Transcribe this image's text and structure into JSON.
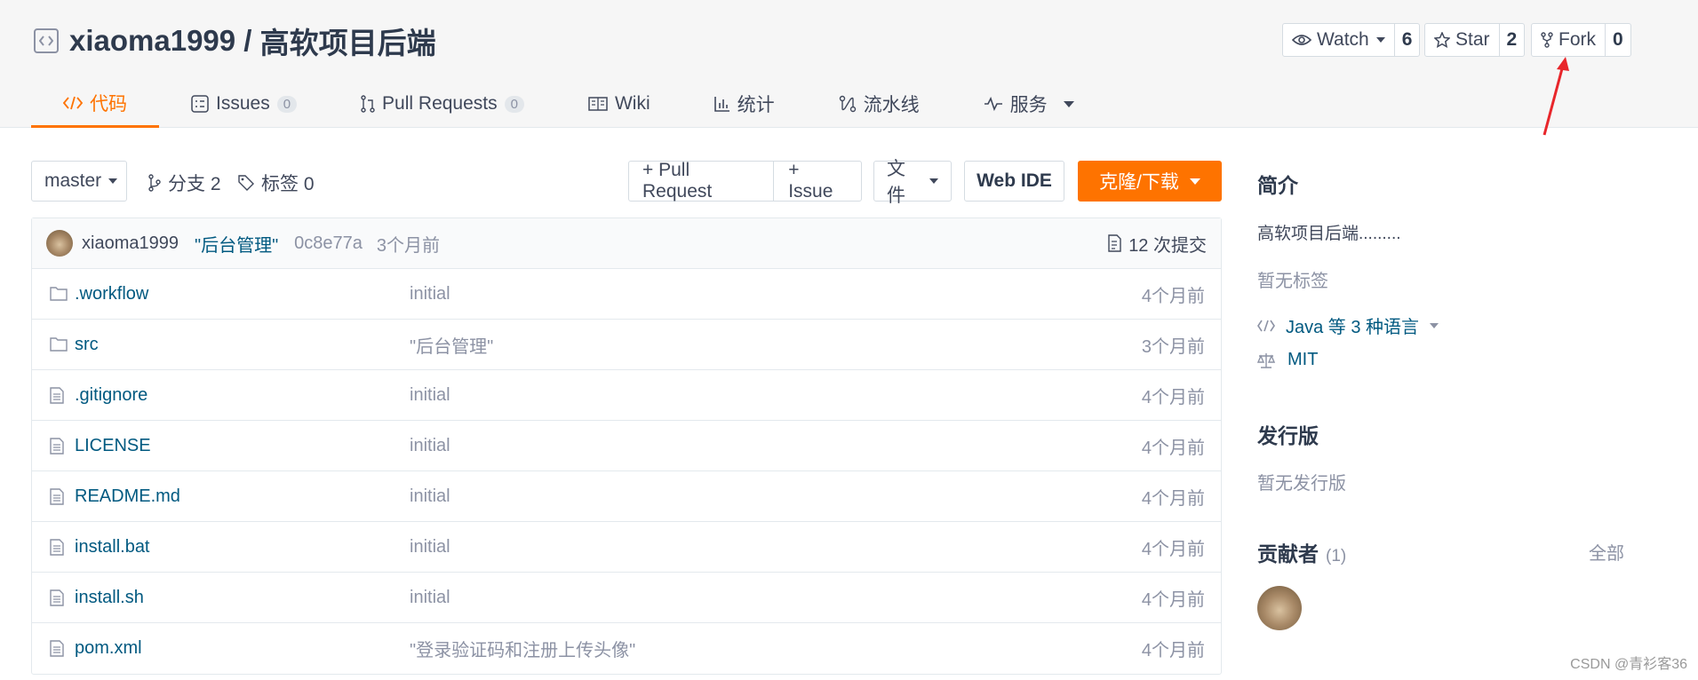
{
  "repo": {
    "owner": "xiaoma1999",
    "separator": " / ",
    "name": "高软项目后端"
  },
  "social": {
    "watch_label": "Watch",
    "watch_count": "6",
    "star_label": "Star",
    "star_count": "2",
    "fork_label": "Fork",
    "fork_count": "0"
  },
  "tabs": [
    {
      "label": "代码",
      "icon": "code-icon",
      "active": true
    },
    {
      "label": "Issues",
      "badge": "0",
      "icon": "issues-icon"
    },
    {
      "label": "Pull Requests",
      "badge": "0",
      "icon": "pull-request-icon"
    },
    {
      "label": "Wiki",
      "icon": "wiki-icon"
    },
    {
      "label": "统计",
      "icon": "stats-icon"
    },
    {
      "label": "流水线",
      "icon": "pipeline-icon"
    },
    {
      "label": "服务",
      "icon": "service-icon"
    }
  ],
  "toolbar": {
    "branch": "master",
    "branches": "分支 2",
    "tags": "标签 0",
    "pull_request": "+ Pull Request",
    "issue": "+ Issue",
    "file": "文件",
    "web_ide": "Web IDE",
    "clone": "克隆/下载"
  },
  "commit": {
    "author": "xiaoma1999",
    "message": "\"后台管理\"",
    "hash": "0c8e77a",
    "time": "3个月前",
    "count": "12 次提交"
  },
  "files": [
    {
      "name": ".workflow",
      "type": "folder",
      "message": "initial",
      "time": "4个月前"
    },
    {
      "name": "src",
      "type": "folder",
      "message": "\"后台管理\"",
      "time": "3个月前"
    },
    {
      "name": ".gitignore",
      "type": "file",
      "message": "initial",
      "time": "4个月前"
    },
    {
      "name": "LICENSE",
      "type": "file",
      "message": "initial",
      "time": "4个月前"
    },
    {
      "name": "README.md",
      "type": "file",
      "message": "initial",
      "time": "4个月前"
    },
    {
      "name": "install.bat",
      "type": "file",
      "message": "initial",
      "time": "4个月前"
    },
    {
      "name": "install.sh",
      "type": "file",
      "message": "initial",
      "time": "4个月前"
    },
    {
      "name": "pom.xml",
      "type": "file",
      "message": "\"登录验证码和注册上传头像\"",
      "time": "4个月前"
    }
  ],
  "sidebar": {
    "intro_title": "简介",
    "intro_text": "高软项目后端.........",
    "no_tags": "暂无标签",
    "languages": "Java 等 3 种语言",
    "license": "MIT",
    "release_title": "发行版",
    "no_release": "暂无发行版",
    "contributors_title": "贡献者",
    "contributors_count": "(1)",
    "all_link": "全部"
  },
  "watermark": "CSDN @青衫客36",
  "colors": {
    "accent": "#fe7300",
    "link": "#005980",
    "muted": "#8c92a4"
  }
}
